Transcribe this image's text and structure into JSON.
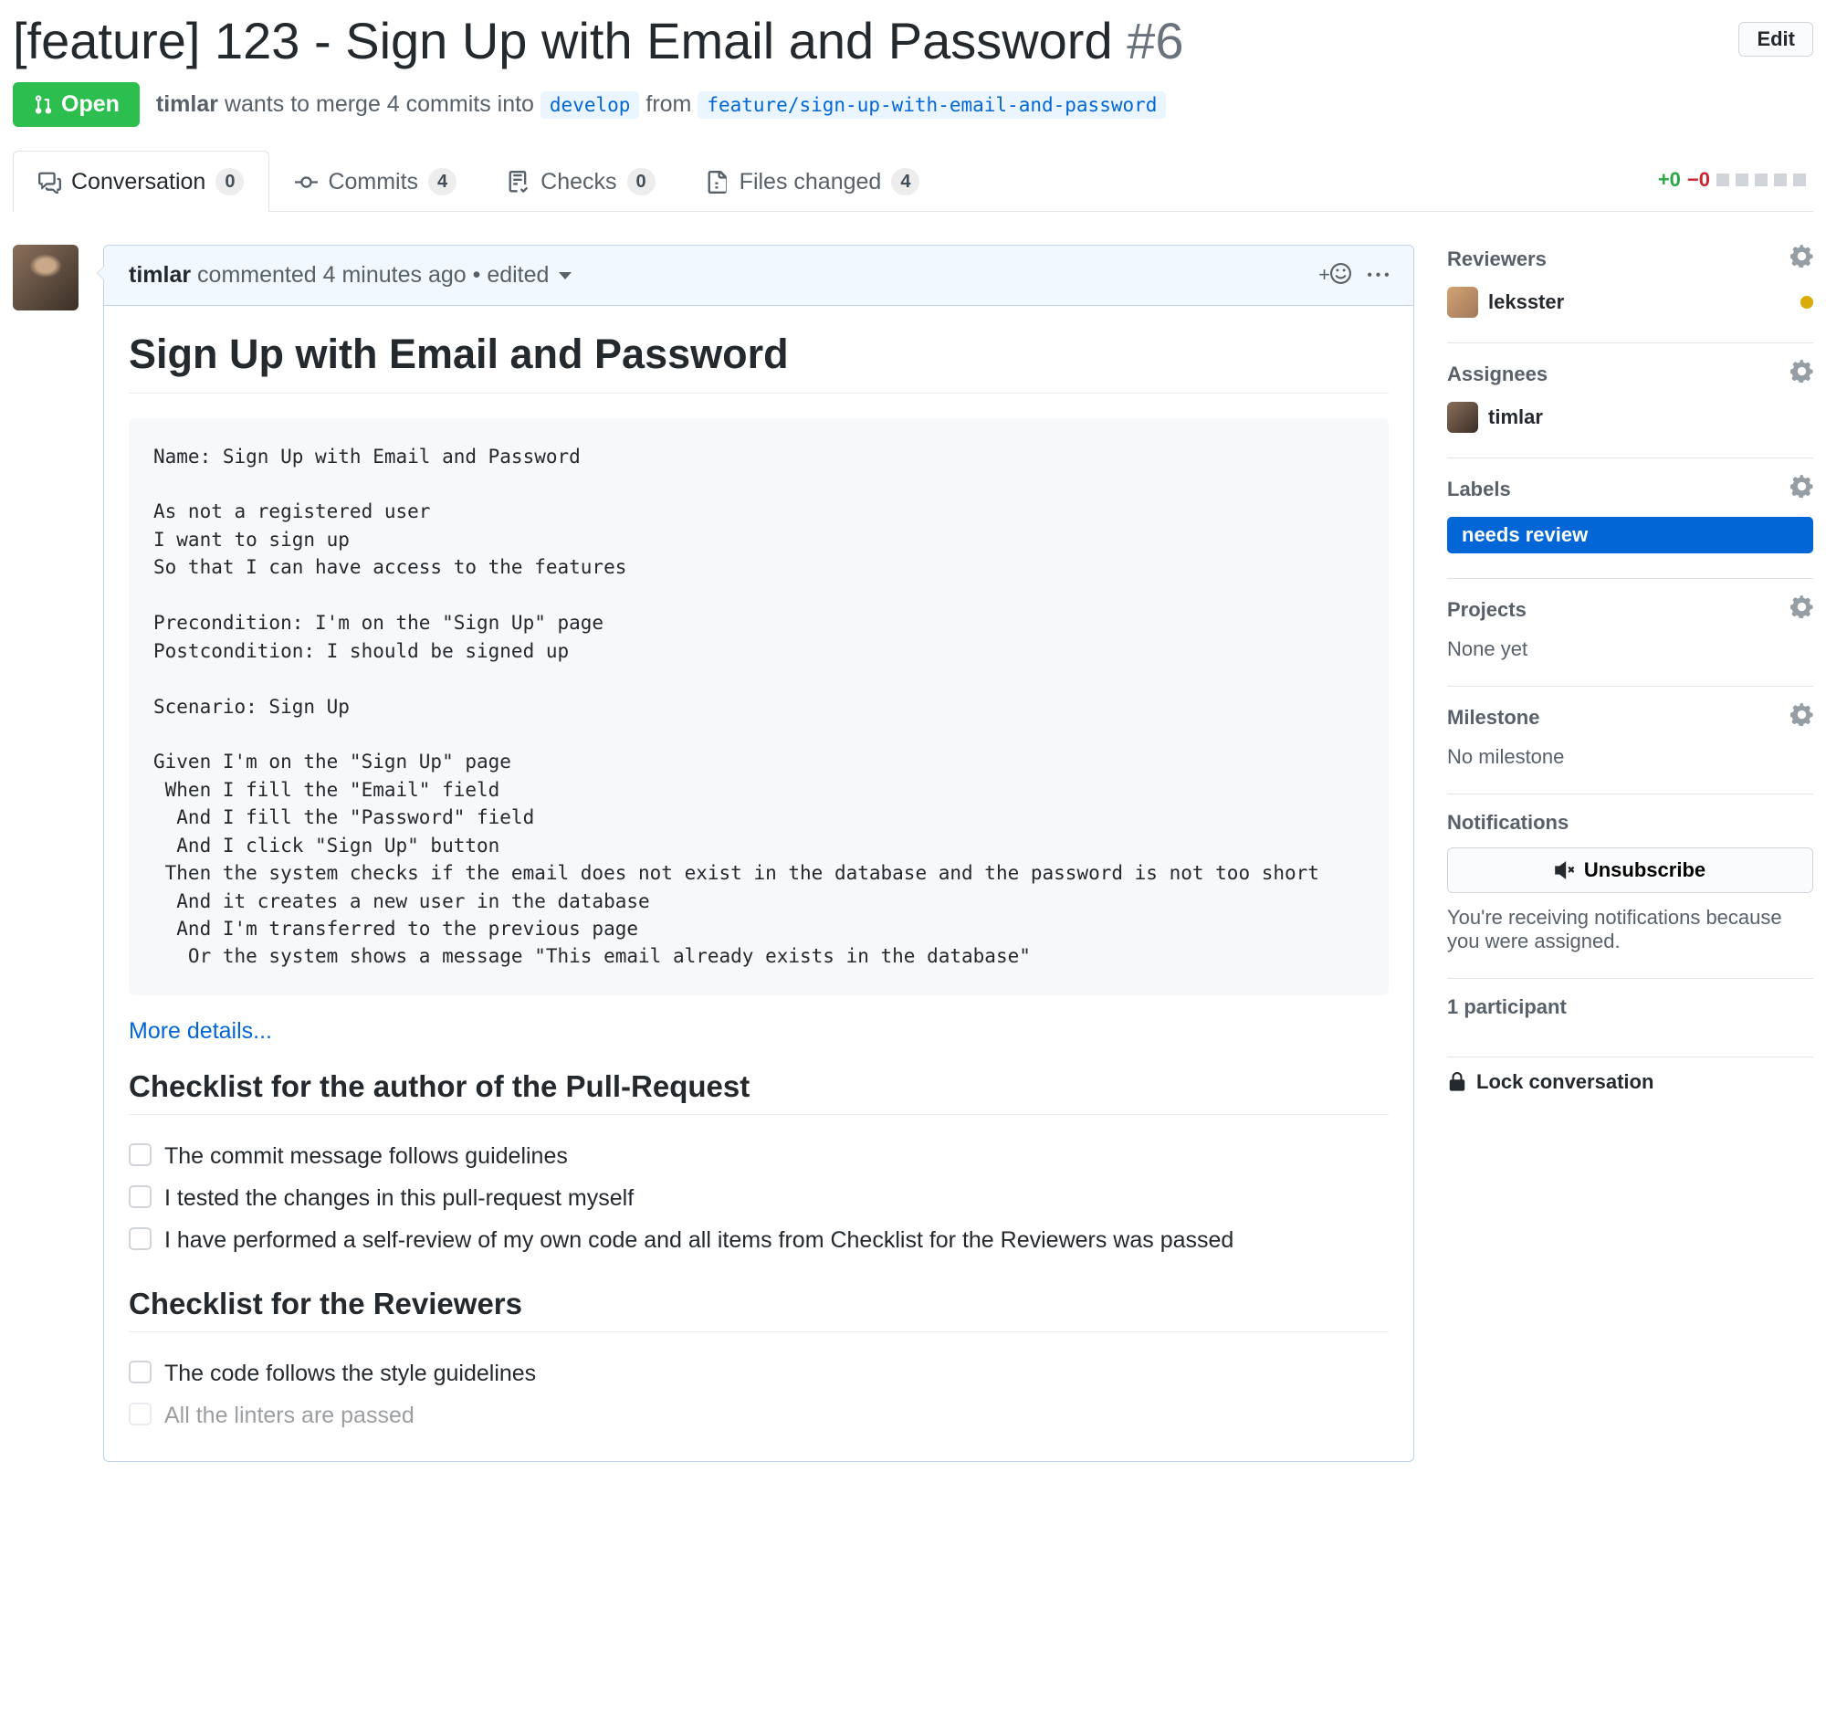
{
  "header": {
    "title": "[feature] 123 - Sign Up with Email and Password",
    "number": "#6",
    "edit_button": "Edit"
  },
  "meta": {
    "state": "Open",
    "author": "timlar",
    "wants_text": " wants to merge 4 commits into ",
    "base_branch": "develop",
    "from_text": " from ",
    "head_branch": "feature/sign-up-with-email-and-password"
  },
  "tabs": {
    "conversation": {
      "label": "Conversation",
      "count": "0"
    },
    "commits": {
      "label": "Commits",
      "count": "4"
    },
    "checks": {
      "label": "Checks",
      "count": "0"
    },
    "files": {
      "label": "Files changed",
      "count": "4"
    }
  },
  "diffstat": {
    "add": "+0",
    "del": "−0"
  },
  "comment": {
    "author": "timlar",
    "commented": " commented ",
    "time": "4 minutes ago",
    "bullet": " • ",
    "edited": "edited",
    "title": "Sign Up with Email and Password",
    "code": "Name: Sign Up with Email and Password\n\nAs not a registered user\nI want to sign up\nSo that I can have access to the features\n\nPrecondition: I'm on the \"Sign Up\" page\nPostcondition: I should be signed up\n\nScenario: Sign Up\n\nGiven I'm on the \"Sign Up\" page\n When I fill the \"Email\" field\n  And I fill the \"Password\" field\n  And I click \"Sign Up\" button\n Then the system checks if the email does not exist in the database and the password is not too short\n  And it creates a new user in the database\n  And I'm transferred to the previous page\n   Or the system shows a message \"This email already exists in the database\"",
    "more_details": "More details...",
    "checklist_author_title": "Checklist for the author of the Pull-Request",
    "checklist_author": [
      "The commit message follows guidelines",
      "I tested the changes in this pull-request myself",
      "I have performed a self-review of my own code and all items from Checklist for the Reviewers was passed"
    ],
    "checklist_reviewers_title": "Checklist for the Reviewers",
    "checklist_reviewers": [
      "The code follows the style guidelines",
      "All the linters are passed"
    ]
  },
  "sidebar": {
    "reviewers": {
      "label": "Reviewers",
      "user": "leksster"
    },
    "assignees": {
      "label": "Assignees",
      "user": "timlar"
    },
    "labels": {
      "label": "Labels",
      "pill": "needs review"
    },
    "projects": {
      "label": "Projects",
      "text": "None yet"
    },
    "milestone": {
      "label": "Milestone",
      "text": "No milestone"
    },
    "notifications": {
      "label": "Notifications",
      "button": "Unsubscribe",
      "text": "You're receiving notifications because you were assigned."
    },
    "participants": {
      "label": "1 participant"
    },
    "lock": "Lock conversation"
  }
}
